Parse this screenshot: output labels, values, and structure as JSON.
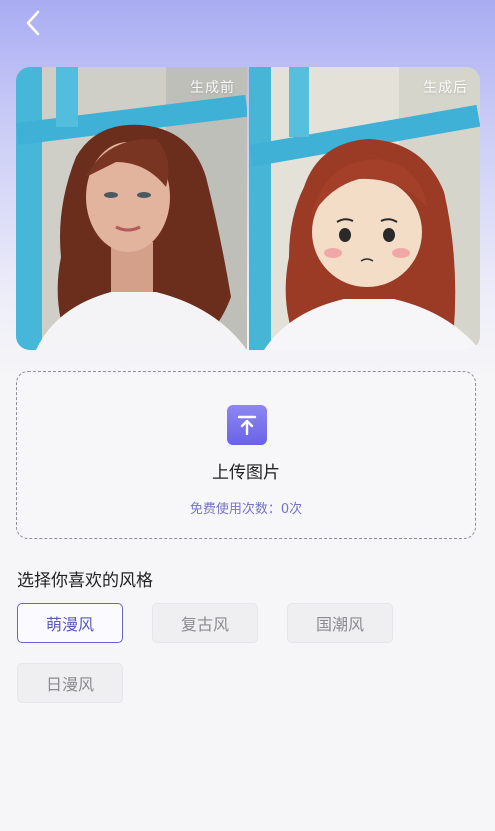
{
  "header": {
    "back_icon": "chevron-left-icon"
  },
  "compare": {
    "before_label": "生成前",
    "after_label": "生成后"
  },
  "upload": {
    "icon": "upload-arrow-icon",
    "title": "上传图片",
    "free_uses_label": "免费使用次数：0次"
  },
  "styles": {
    "title": "选择你喜欢的风格",
    "options": [
      {
        "label": "萌漫风",
        "selected": true
      },
      {
        "label": "复古风",
        "selected": false
      },
      {
        "label": "国潮风",
        "selected": false
      },
      {
        "label": "日漫风",
        "selected": false
      }
    ]
  },
  "colors": {
    "accent": "#6965c8",
    "upload_icon_bg": "#7a74ec"
  }
}
